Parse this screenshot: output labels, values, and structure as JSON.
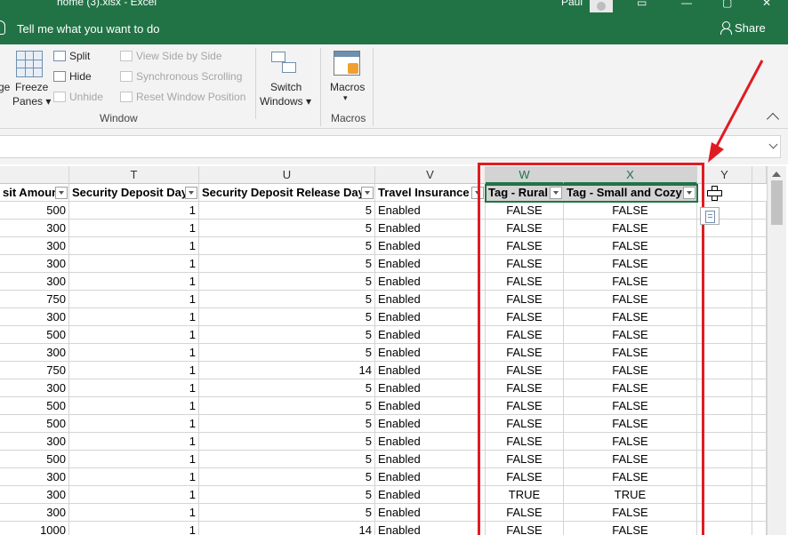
{
  "window": {
    "title": "home (3).xlsx  -  Excel",
    "user": "Paul",
    "tell_me": "Tell me what you want to do",
    "share": "Share"
  },
  "ribbon": {
    "freeze_label_1": "Freeze",
    "freeze_label_2": "Panes",
    "freeze_prefix": "ge",
    "split": "Split",
    "hide": "Hide",
    "unhide": "Unhide",
    "view_side": "View Side by Side",
    "sync_scroll": "Synchronous Scrolling",
    "reset_pos": "Reset Window Position",
    "switch_1": "Switch",
    "switch_2": "Windows",
    "macros": "Macros",
    "group_window": "Window",
    "group_macros": "Macros"
  },
  "columns": {
    "T": "T",
    "U": "U",
    "V": "V",
    "W": "W",
    "X": "X",
    "Y": "Y"
  },
  "headers": {
    "s": "sit Amoun",
    "t": "Security Deposit Day",
    "u": "Security Deposit Release Day",
    "v": "Travel Insurance",
    "w": "Tag - Rural",
    "x": "Tag - Small and Cozy"
  },
  "rows": [
    {
      "s": "500",
      "t": "1",
      "u": "5",
      "v": "Enabled",
      "w": "FALSE",
      "x": "FALSE"
    },
    {
      "s": "300",
      "t": "1",
      "u": "5",
      "v": "Enabled",
      "w": "FALSE",
      "x": "FALSE"
    },
    {
      "s": "300",
      "t": "1",
      "u": "5",
      "v": "Enabled",
      "w": "FALSE",
      "x": "FALSE"
    },
    {
      "s": "300",
      "t": "1",
      "u": "5",
      "v": "Enabled",
      "w": "FALSE",
      "x": "FALSE"
    },
    {
      "s": "300",
      "t": "1",
      "u": "5",
      "v": "Enabled",
      "w": "FALSE",
      "x": "FALSE"
    },
    {
      "s": "750",
      "t": "1",
      "u": "5",
      "v": "Enabled",
      "w": "FALSE",
      "x": "FALSE"
    },
    {
      "s": "300",
      "t": "1",
      "u": "5",
      "v": "Enabled",
      "w": "FALSE",
      "x": "FALSE"
    },
    {
      "s": "500",
      "t": "1",
      "u": "5",
      "v": "Enabled",
      "w": "FALSE",
      "x": "FALSE"
    },
    {
      "s": "300",
      "t": "1",
      "u": "5",
      "v": "Enabled",
      "w": "FALSE",
      "x": "FALSE"
    },
    {
      "s": "750",
      "t": "1",
      "u": "14",
      "v": "Enabled",
      "w": "FALSE",
      "x": "FALSE"
    },
    {
      "s": "300",
      "t": "1",
      "u": "5",
      "v": "Enabled",
      "w": "FALSE",
      "x": "FALSE"
    },
    {
      "s": "500",
      "t": "1",
      "u": "5",
      "v": "Enabled",
      "w": "FALSE",
      "x": "FALSE"
    },
    {
      "s": "500",
      "t": "1",
      "u": "5",
      "v": "Enabled",
      "w": "FALSE",
      "x": "FALSE"
    },
    {
      "s": "300",
      "t": "1",
      "u": "5",
      "v": "Enabled",
      "w": "FALSE",
      "x": "FALSE"
    },
    {
      "s": "500",
      "t": "1",
      "u": "5",
      "v": "Enabled",
      "w": "FALSE",
      "x": "FALSE"
    },
    {
      "s": "300",
      "t": "1",
      "u": "5",
      "v": "Enabled",
      "w": "FALSE",
      "x": "FALSE"
    },
    {
      "s": "300",
      "t": "1",
      "u": "5",
      "v": "Enabled",
      "w": "TRUE",
      "x": "TRUE"
    },
    {
      "s": "300",
      "t": "1",
      "u": "5",
      "v": "Enabled",
      "w": "FALSE",
      "x": "FALSE"
    },
    {
      "s": "1000",
      "t": "1",
      "u": "14",
      "v": "Enabled",
      "w": "FALSE",
      "x": "FALSE"
    }
  ],
  "colors": {
    "excel_green": "#217346",
    "highlight_red": "#e01b22"
  }
}
